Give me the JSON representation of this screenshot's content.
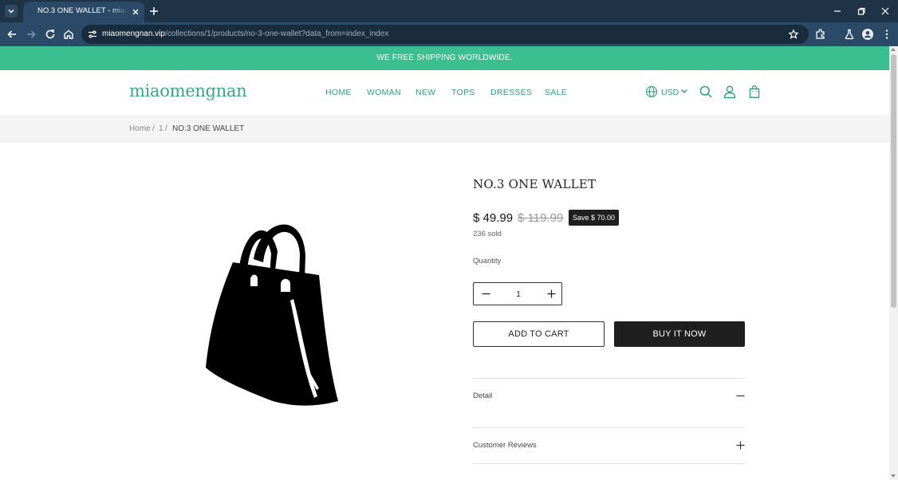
{
  "browser": {
    "tab_title": "NO.3 ONE WALLET - miaomengnan",
    "url_host": "miaomengnan.vip",
    "url_path": "/collections/1/products/no-3-one-wallet?data_from=index_index"
  },
  "announcement": "WE FREE SHIPPING WORLDWIDE.",
  "header": {
    "logo": "miaomengnan",
    "nav": [
      "HOME",
      "WOMAN",
      "NEW",
      "TOPS",
      "DRESSES",
      "SALE"
    ],
    "currency": "USD"
  },
  "breadcrumb": {
    "home": "Home",
    "separator": "/",
    "collection": "1",
    "current": "NO.3 ONE WALLET"
  },
  "product": {
    "title": "NO.3 ONE WALLET",
    "price": "$ 49.99",
    "compare_price": "$ 119.99",
    "save_badge": "Save $ 70.00",
    "sold": "236 sold",
    "quantity_label": "Quantity",
    "quantity_value": "1",
    "add_to_cart": "ADD TO CART",
    "buy_now": "BUY IT NOW",
    "image_icon": "handbag-icon"
  },
  "accordion": [
    {
      "label": "Detail",
      "state": "expanded"
    },
    {
      "label": "Customer Reviews",
      "state": "collapsed"
    }
  ],
  "colors": {
    "brand_green": "#3cbf90",
    "nav_green": "#2fa07a",
    "button_dark": "#1f1f1f",
    "chrome_dark": "#1f3347",
    "chrome_toolbar": "#2b4a67"
  }
}
